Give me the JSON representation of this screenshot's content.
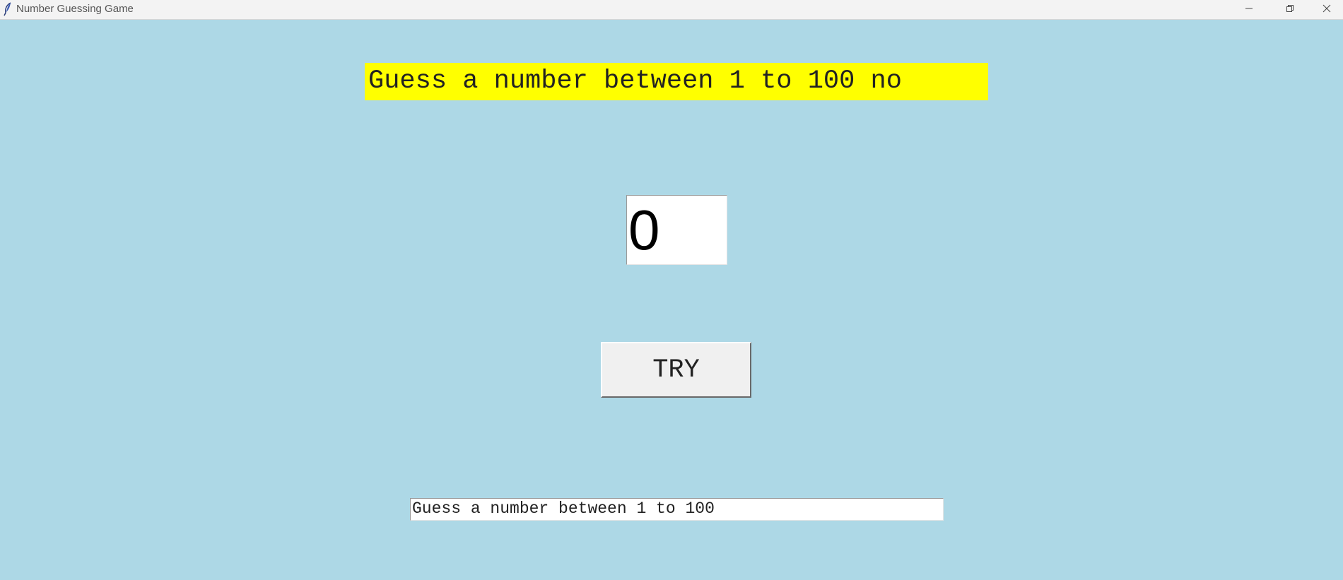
{
  "window": {
    "title": "Number Guessing Game",
    "app_icon": "feather-icon",
    "controls": [
      "minimize-icon",
      "restore-icon",
      "close-icon"
    ]
  },
  "game": {
    "heading": "Guess a number between 1 to 100 no",
    "guess_value": "0",
    "try_label": "TRY",
    "status_text": "Guess a number between 1 to 100"
  },
  "colors": {
    "background": "#add8e6",
    "heading_background": "#ffff00",
    "field_background": "#ffffff",
    "button_background": "#f0f0f0"
  }
}
